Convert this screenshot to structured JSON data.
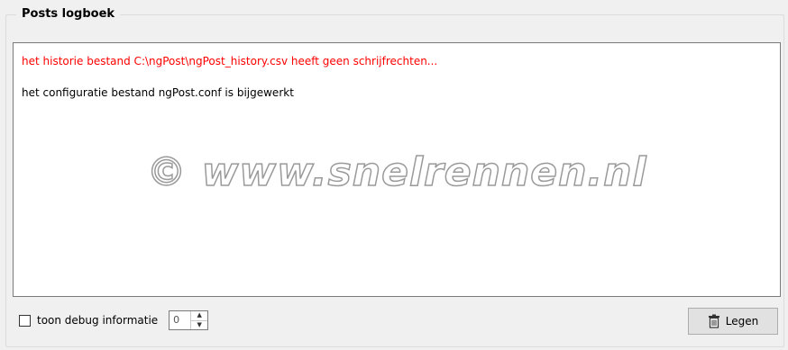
{
  "group": {
    "title": "Posts logboek"
  },
  "log": {
    "lines": [
      {
        "text": "het historie bestand C:\\ngPost\\ngPost_history.csv heeft geen schrijfrechten...",
        "color": "#ff0000"
      },
      {
        "text": "het configuratie bestand ngPost.conf  is bijgewerkt",
        "color": "#000000"
      }
    ],
    "watermark": "© www.snelrennen.nl"
  },
  "debug": {
    "checkbox_label": "toon debug informatie",
    "checked": false,
    "level_value": "0"
  },
  "buttons": {
    "clear_label": "Legen",
    "clear_icon": "trash-icon"
  }
}
